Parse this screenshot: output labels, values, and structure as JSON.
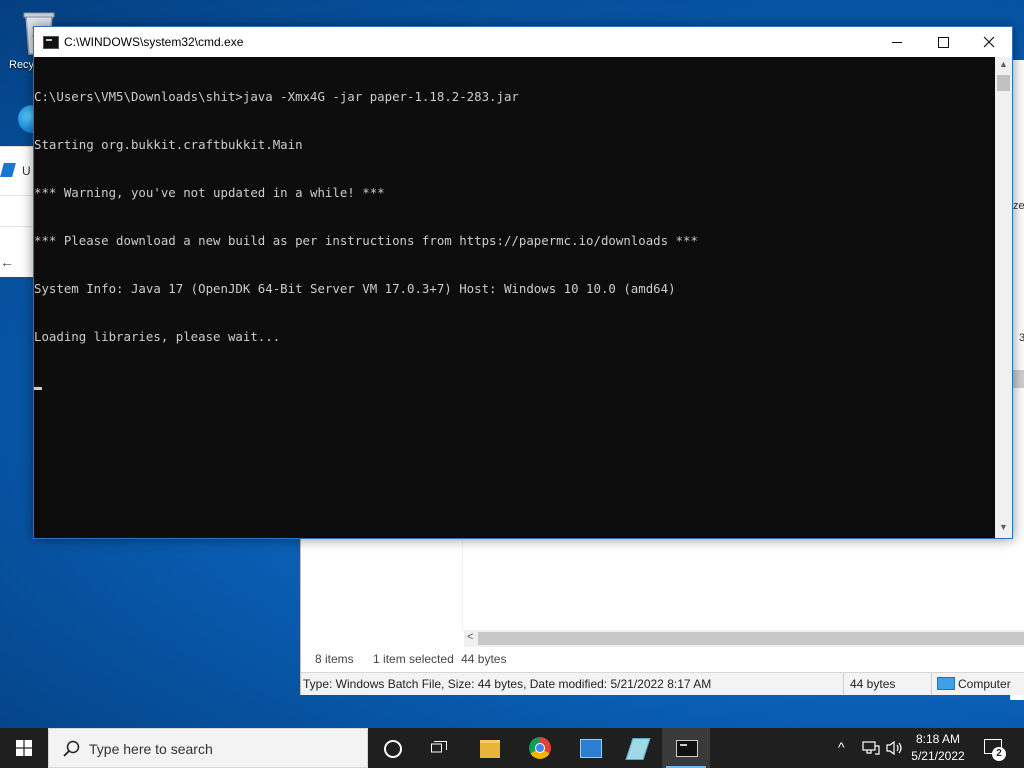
{
  "desktop": {
    "recycle_bin_label": "Recy",
    "explorer_fragment_letter": "U",
    "explorer_right_text_1": "ze",
    "explorer_right_text_2": "3"
  },
  "cmd_window": {
    "title": "C:\\WINDOWS\\system32\\cmd.exe",
    "lines": [
      "C:\\Users\\VM5\\Downloads\\shit>java -Xmx4G -jar paper-1.18.2-283.jar",
      "Starting org.bukkit.craftbukkit.Main",
      "*** Warning, you've not updated in a while! ***",
      "*** Please download a new build as per instructions from https://papermc.io/downloads ***",
      "System Info: Java 17 (OpenJDK 64-Bit Server VM 17.0.3+7) Host: Windows 10 10.0 (amd64)",
      "Loading libraries, please wait..."
    ]
  },
  "explorer": {
    "item_count": "8 items",
    "selection": "1 item selected",
    "selection_size": "44 bytes",
    "details_info": "Type: Windows Batch File, Size: 44 bytes, Date modified: 5/21/2022 8:17 AM",
    "details_size": "44 bytes",
    "details_location": "Computer"
  },
  "taskbar": {
    "search_placeholder": "Type here to search",
    "time": "8:18 AM",
    "date": "5/21/2022",
    "notification_count": "2"
  }
}
